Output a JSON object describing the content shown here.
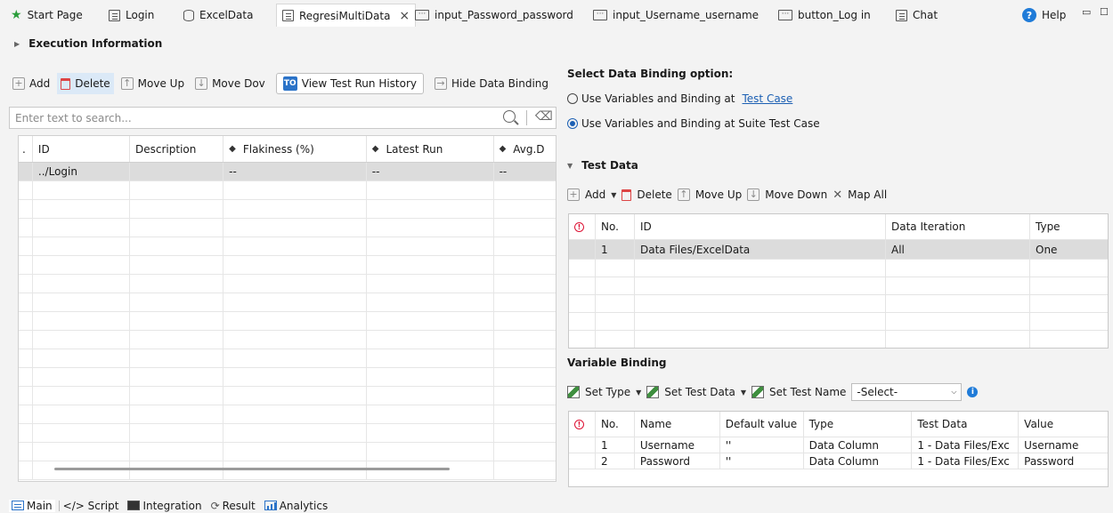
{
  "tabs": [
    {
      "label": "Start Page",
      "icon": "star-icon"
    },
    {
      "label": "Login",
      "icon": "sheet-icon"
    },
    {
      "label": "ExcelData",
      "icon": "database-icon"
    },
    {
      "label": "RegresiMultiData",
      "icon": "sheet-icon",
      "close": "×"
    },
    {
      "label": "input_Password_password",
      "icon": "object-icon"
    },
    {
      "label": "input_Username_username",
      "icon": "object-icon"
    },
    {
      "label": "button_Log in",
      "icon": "object-icon"
    },
    {
      "label": "Chat",
      "icon": "sheet-icon"
    }
  ],
  "help": {
    "label": "Help",
    "glyph": "?"
  },
  "execution": {
    "title": "Execution Information"
  },
  "left_toolbar": {
    "add": "Add",
    "delete": "Delete",
    "move_up": "Move Up",
    "move_down": "Move Dov",
    "view_history": "View Test Run History",
    "hide_binding": "Hide Data Binding"
  },
  "search": {
    "placeholder": "Enter text to search..."
  },
  "left_table": {
    "columns": [
      ".",
      "ID",
      "Description",
      "Flakiness (%)",
      "Latest Run",
      "Avg.D"
    ],
    "rows": [
      {
        "id": "../Login",
        "description": "",
        "flakiness": "--",
        "latest_run": "--",
        "avg": "--"
      }
    ]
  },
  "binding": {
    "title": "Select Data Binding option:",
    "option1": "Use Variables and Binding at",
    "option1_link": "Test Case",
    "option2": "Use Variables and Binding at Suite Test Case"
  },
  "test_data": {
    "title": "Test Data",
    "toolbar": {
      "add": "Add",
      "delete": "Delete",
      "move_up": "Move Up",
      "move_down": "Move Down",
      "map_all": "Map All"
    },
    "columns": [
      "!",
      "No.",
      "ID",
      "Data Iteration",
      "Type"
    ],
    "rows": [
      {
        "no": "1",
        "id": "Data Files/ExcelData",
        "iteration": "All",
        "type": "One"
      }
    ]
  },
  "variable_binding": {
    "title": "Variable Binding",
    "toolbar": {
      "set_type": "Set Type",
      "set_test_data": "Set Test Data",
      "set_test_name": "Set Test Name",
      "select_value": "-Select-"
    },
    "columns": [
      "!",
      "No.",
      "Name",
      "Default value",
      "Type",
      "Test Data",
      "Value"
    ],
    "rows": [
      {
        "no": "1",
        "name": "Username",
        "default": "''",
        "type": "Data Column",
        "test_data": "1 - Data Files/Exc",
        "value": "Username"
      },
      {
        "no": "2",
        "name": "Password",
        "default": "''",
        "type": "Data Column",
        "test_data": "1 - Data Files/Exc",
        "value": "Password"
      }
    ]
  },
  "bottom_tabs": [
    {
      "label": "Main",
      "icon": "list-icon"
    },
    {
      "label": "</> Script",
      "icon": ""
    },
    {
      "label": "Integration",
      "icon": "integration-icon"
    },
    {
      "label": "Result",
      "icon": "result-icon"
    },
    {
      "label": "Analytics",
      "icon": "chart-icon"
    }
  ]
}
